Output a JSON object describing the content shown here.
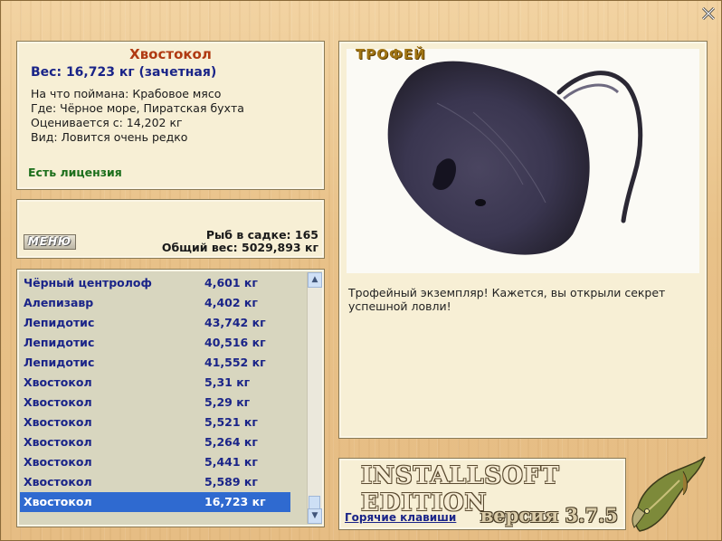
{
  "info": {
    "fish_name": "Хвостокол",
    "weight_line": "Вес: 16,723 кг (зачетная)",
    "bait_line": "На что поймана: Крабовое мясо",
    "place_line": "Где: Чёрное море, Пиратская бухта",
    "valued_line": "Оценивается с: 14,202 кг",
    "kind_line": "Вид: Ловится очень редко",
    "license": "Есть лицензия"
  },
  "middle": {
    "menu_label": "МЕНЮ",
    "fish_in_cage": "Рыб в садке: 165",
    "total_weight": "Общий вес: 5029,893 кг"
  },
  "catch_list": {
    "rows": [
      {
        "name": "Чёрный центролоф",
        "weight": "4,601 кг"
      },
      {
        "name": "Алепизавр",
        "weight": "4,402 кг"
      },
      {
        "name": "Лепидотис",
        "weight": "43,742 кг"
      },
      {
        "name": "Лепидотис",
        "weight": "40,516 кг"
      },
      {
        "name": "Лепидотис",
        "weight": "41,552 кг"
      },
      {
        "name": "Хвостокол",
        "weight": "5,31 кг"
      },
      {
        "name": "Хвостокол",
        "weight": "5,29 кг"
      },
      {
        "name": "Хвостокол",
        "weight": "5,521 кг"
      },
      {
        "name": "Хвостокол",
        "weight": "5,264 кг"
      },
      {
        "name": "Хвостокол",
        "weight": "5,441 кг"
      },
      {
        "name": "Хвостокол",
        "weight": "5,589 кг"
      },
      {
        "name": "Хвостокол",
        "weight": "16,723 кг"
      }
    ],
    "selected_index": 11
  },
  "trophy": {
    "label": "ТРОФЕЙ",
    "description": "Трофейный экземпляр! Кажется, вы открыли секрет успешной ловли!"
  },
  "bottom": {
    "brand": "INSTALLSOFT EDITION",
    "hotkeys_link": "Горячие клавиши",
    "version": "версия 3.7.5"
  },
  "colors": {
    "title": "#b03a12",
    "weight": "#1a2488",
    "license": "#1b6e1b",
    "selection": "#2f6ad0"
  },
  "icons": {
    "close": "close-icon",
    "scroll_up": "chevron-up-icon",
    "scroll_down": "chevron-down-icon"
  }
}
